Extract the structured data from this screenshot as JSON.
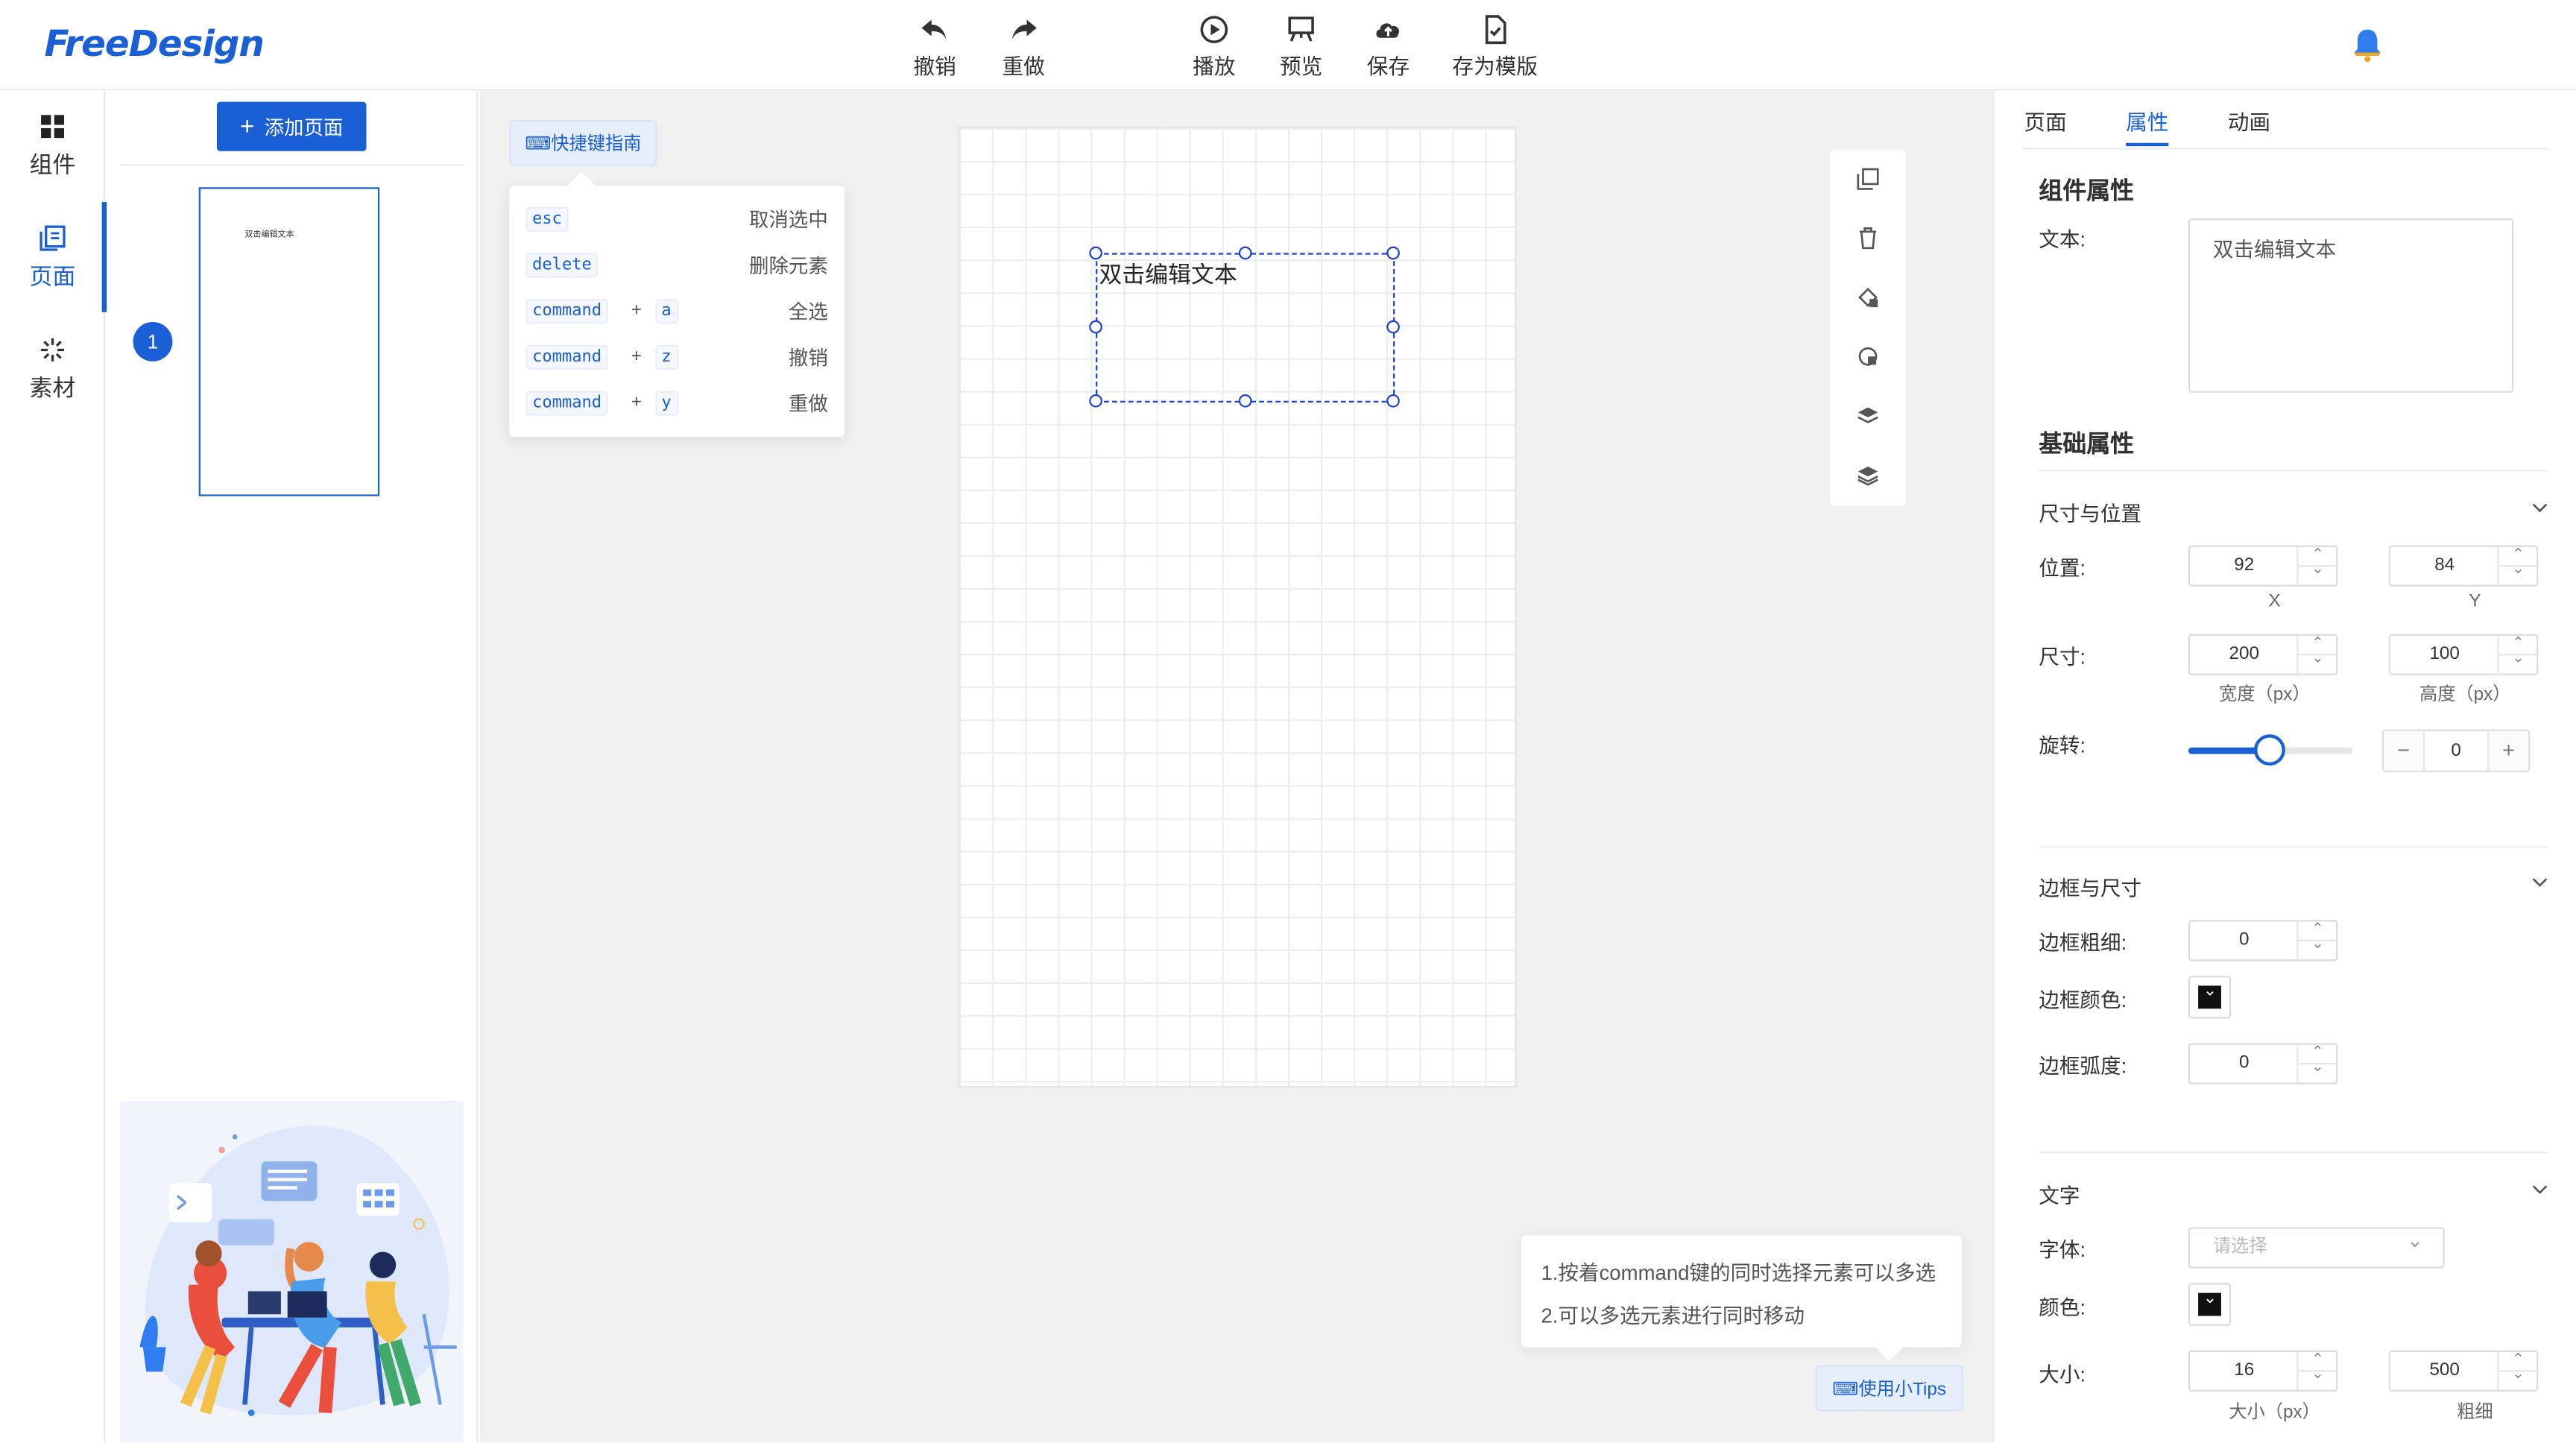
{
  "app": {
    "logo": "FreeDesign"
  },
  "toolbar": {
    "undo": "撤销",
    "redo": "重做",
    "play": "播放",
    "preview": "预览",
    "save": "保存",
    "save_template": "存为模版"
  },
  "rail": {
    "components": "组件",
    "pages": "页面",
    "materials": "素材"
  },
  "pages_panel": {
    "add_page": "添加页面",
    "page_number": "1",
    "thumb_text": "双击编辑文本"
  },
  "stage": {
    "shortcut_button": "⌨快捷键指南",
    "shortcuts": [
      {
        "keys": [
          "esc"
        ],
        "desc": "取消选中"
      },
      {
        "keys": [
          "delete"
        ],
        "desc": "删除元素"
      },
      {
        "keys": [
          "command",
          "a"
        ],
        "desc": "全选"
      },
      {
        "keys": [
          "command",
          "z"
        ],
        "desc": "撤销"
      },
      {
        "keys": [
          "command",
          "y"
        ],
        "desc": "重做"
      }
    ],
    "plus": "+",
    "element_text": "双击编辑文本",
    "tips": [
      "1.按着command键的同时选择元素可以多选",
      "2.可以多选元素进行同时移动"
    ],
    "tips_button": "⌨使用小Tips"
  },
  "right_panel": {
    "tabs": [
      "页面",
      "属性",
      "动画"
    ],
    "component_props": "组件属性",
    "text_label": "文本:",
    "text_value": "双击编辑文本",
    "basic_props": "基础属性",
    "size_position": "尺寸与位置",
    "position_label": "位置:",
    "x_value": "92",
    "y_value": "84",
    "x_caption": "X",
    "y_caption": "Y",
    "size_label": "尺寸:",
    "width_value": "200",
    "height_value": "100",
    "width_caption": "宽度（px）",
    "height_caption": "高度（px）",
    "rotate_label": "旋转:",
    "rotate_value": "0",
    "rotate_slider_fraction": 0.5,
    "border_section": "边框与尺寸",
    "border_width_label": "边框粗细:",
    "border_width_value": "0",
    "border_color_label": "边框颜色:",
    "border_color": "#111111",
    "border_radius_label": "边框弧度:",
    "border_radius_value": "0",
    "text_section": "文字",
    "font_label": "字体:",
    "font_placeholder": "请选择",
    "color_label": "颜色:",
    "size_font_label": "大小:",
    "font_size_value": "16",
    "font_weight_value": "500",
    "font_size_caption": "大小（px）",
    "font_weight_caption": "粗细"
  },
  "colors": {
    "accent": "#1a5fd6",
    "stage_bg": "#f0f0f0"
  }
}
